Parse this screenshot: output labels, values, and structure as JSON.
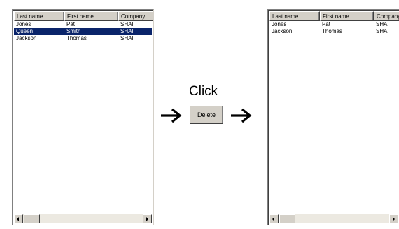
{
  "columns": [
    "Last name",
    "First name",
    "Company"
  ],
  "before": {
    "rows": [
      {
        "last": "Jones",
        "first": "Pat",
        "company": "SHAI"
      },
      {
        "last": "Queen",
        "first": "Smith",
        "company": "SHAI",
        "selected": true
      },
      {
        "last": "Jackson",
        "first": "Thomas",
        "company": "SHAI"
      }
    ]
  },
  "after": {
    "rows": [
      {
        "last": "Jones",
        "first": "Pat",
        "company": "SHAI"
      },
      {
        "last": "Jackson",
        "first": "Thomas",
        "company": "SHAI"
      }
    ]
  },
  "action": {
    "click_label": "Click",
    "button_label": "Delete"
  },
  "icons": {
    "flow_arrow": "arrow-right",
    "scroll_left": "scroll-left-arrow",
    "scroll_right": "scroll-right-arrow"
  },
  "colors": {
    "selection": "#0a246a",
    "button_face": "#d4d0c8"
  }
}
